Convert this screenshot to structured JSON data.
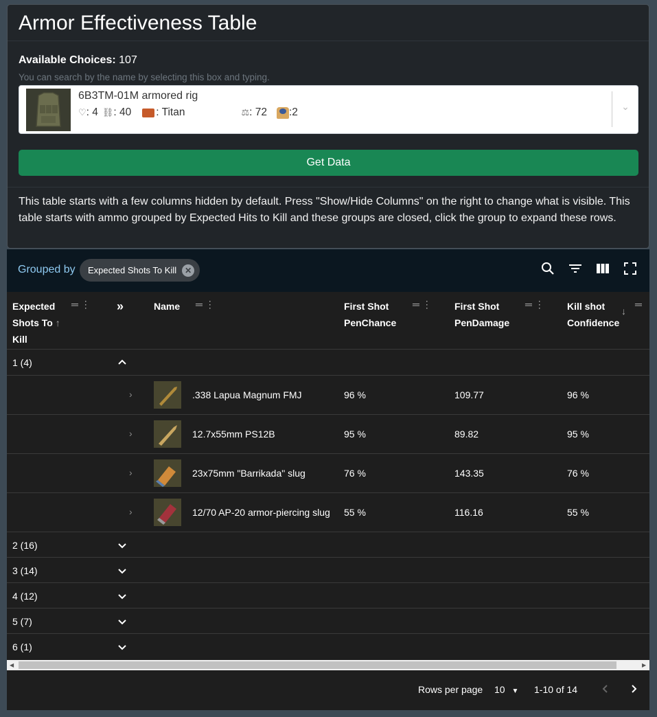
{
  "title": "Armor Effectiveness Table",
  "choices": {
    "label": "Available Choices:",
    "count": "107"
  },
  "hint": "You can search by the name by selecting this box and typing.",
  "selected": {
    "name": "6B3TM-01M armored rig",
    "armor_class": ": 4",
    "durability": ": 40",
    "material": ": Titan",
    "weight": ": 72",
    "ergo": ":2"
  },
  "get_data": "Get Data",
  "note": "This table starts with a few columns hidden by default. Press \"Show/Hide Columns\" on the right to change what is visible. This table starts with ammo grouped by Expected Hits to Kill and these groups are closed, click the group to expand these rows.",
  "toolbar": {
    "grouped_by": "Grouped by",
    "chip": "Expected Shots To Kill"
  },
  "columns": {
    "expected": [
      "Expected",
      "Shots To",
      "Kill"
    ],
    "name": "Name",
    "pen_chance": [
      "First Shot",
      "PenChance"
    ],
    "pen_damage": [
      "First Shot",
      "PenDamage"
    ],
    "kill_conf": [
      "Kill shot",
      "Confidence"
    ]
  },
  "groups": [
    {
      "label": "1 (4)",
      "expanded": true
    },
    {
      "label": "2 (16)"
    },
    {
      "label": "3 (14)"
    },
    {
      "label": "4 (12)"
    },
    {
      "label": "5 (7)"
    },
    {
      "label": "6 (1)"
    }
  ],
  "rows": [
    {
      "name": ".338 Lapua Magnum FMJ",
      "pen_chance": "96 %",
      "pen_damage": "109.77",
      "kill_conf": "96 %",
      "color": "#b08a3a"
    },
    {
      "name": "12.7x55mm PS12B",
      "pen_chance": "95 %",
      "pen_damage": "89.82",
      "kill_conf": "95 %",
      "color": "#c9a760"
    },
    {
      "name": "23x75mm \"Barrikada\" slug",
      "pen_chance": "76 %",
      "pen_damage": "143.35",
      "kill_conf": "76 %",
      "color": "#d08a3a"
    },
    {
      "name": "12/70 AP-20 armor-piercing slug",
      "pen_chance": "55 %",
      "pen_damage": "116.16",
      "kill_conf": "55 %",
      "color": "#a3323c"
    }
  ],
  "pager": {
    "rows_per_page_label": "Rows per page",
    "rows_per_page": "10",
    "range": "1-10 of 14"
  }
}
